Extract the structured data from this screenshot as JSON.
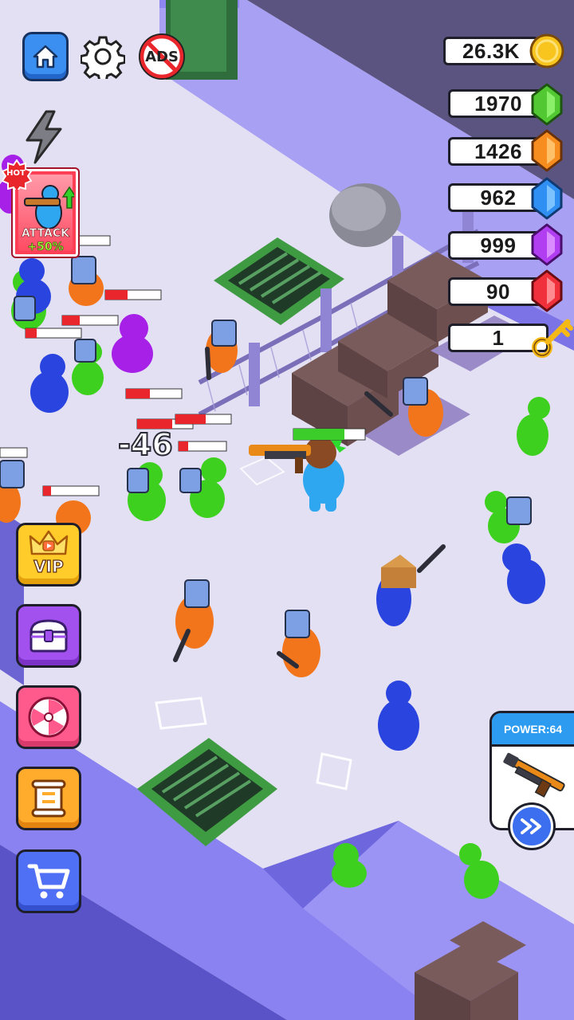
{
  "top_buttons": {
    "home": "home-icon",
    "settings": "gear-icon",
    "no_ads_label": "ADS"
  },
  "currencies": [
    {
      "id": "coins",
      "value": "26.3K",
      "icon": "gold-coin-icon",
      "color": "#f7c51e"
    },
    {
      "id": "green-gem",
      "value": "1970",
      "icon": "green-gem-icon",
      "color": "#52c832"
    },
    {
      "id": "orange-gem",
      "value": "1426",
      "icon": "orange-gem-icon",
      "color": "#f88d1f"
    },
    {
      "id": "blue-gem",
      "value": "962",
      "icon": "blue-gem-icon",
      "color": "#2f8ff2"
    },
    {
      "id": "purple-gem",
      "value": "999",
      "icon": "purple-gem-icon",
      "color": "#b13ef0"
    },
    {
      "id": "red-gem",
      "value": "90",
      "icon": "red-gem-icon",
      "color": "#f0303a"
    },
    {
      "id": "key",
      "value": "1",
      "icon": "gold-key-icon",
      "color": "#f5b915"
    }
  ],
  "attack_boost": {
    "badge": "HOT",
    "title": "ATTACK",
    "bonus": "+50%"
  },
  "side_menu": {
    "vip_label": "VIP",
    "chest": "treasure-chest-icon",
    "wheel": "lucky-wheel-icon",
    "quest": "scroll-icon",
    "shop": "shopping-cart-icon"
  },
  "power_card": {
    "label": "POWER:64",
    "weapon": "shotgun-icon",
    "action": "fast-forward-icon"
  },
  "combat": {
    "damage_text": "-46"
  },
  "colors": {
    "floor": "#e4e1f4",
    "wall": "#8e86f0",
    "enemy_green": "#3ed01f",
    "enemy_blue": "#2a44e0",
    "enemy_orange": "#f2751b",
    "enemy_purple": "#a620e8",
    "player": "#2fa7f0"
  }
}
